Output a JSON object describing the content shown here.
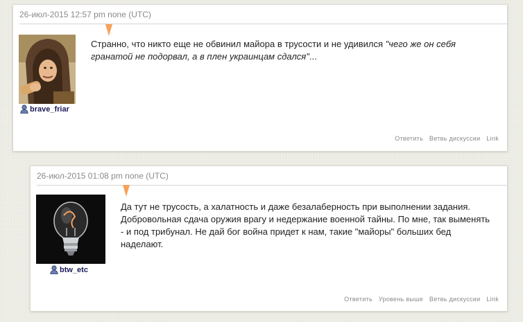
{
  "comments": [
    {
      "meta": "26-июл-2015 12:57 pm none (UTC)",
      "username": "brave_friar",
      "text_plain": "Странно, что никто еще не обвинил майора в трусости и не удивился ",
      "text_quote": "\"чего же он себя гранатой не подорвал, а в плен украинцам сдался\"",
      "text_tail": "...",
      "actions": [
        "Ответить",
        "Ветвь дискуссии",
        "Link"
      ]
    },
    {
      "meta": "26-июл-2015 01:08 pm none (UTC)",
      "username": "btw_etc",
      "text": "Да тут не трусость, а халатность и даже безалаберность при выполнении задания. Добровольная сдача оружия врагу и недержание военной тайны. По мне, так выменять - и под трибунал. Не дай бог война придет к нам, такие \"майоры\" больших бед наделают.",
      "actions": [
        "Ответить",
        "Уровень выше",
        "Ветвь дискуссии",
        "Link"
      ]
    }
  ],
  "colors": {
    "pointer": "#f7a15a",
    "username": "#1a1a5a",
    "meta": "#8a8a8a"
  },
  "icons": {
    "user": "user-icon",
    "avatar1": "hooded-friar-avatar",
    "avatar2": "light-bulb-avatar"
  }
}
